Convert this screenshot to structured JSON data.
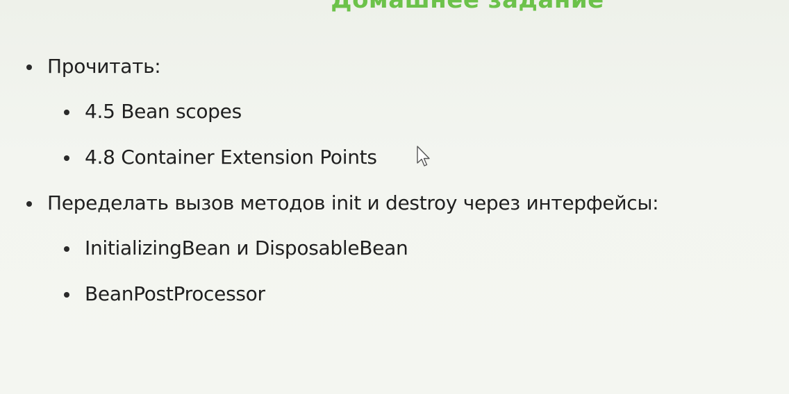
{
  "slide": {
    "title": "Домашнее задание",
    "items": [
      {
        "level": 1,
        "text": "Прочитать:"
      },
      {
        "level": 2,
        "text": "4.5 Bean scopes"
      },
      {
        "level": 2,
        "text": "4.8 Container Extension Points"
      },
      {
        "level": 1,
        "text": "Переделать вызов методов init и destroy через интерфейсы:"
      },
      {
        "level": 2,
        "text": "InitializingBean и DisposableBean"
      },
      {
        "level": 2,
        "text": "BeanPostProcessor"
      }
    ]
  },
  "colors": {
    "title": "#6cc24a",
    "text": "#1f1f1f",
    "background": "#f2f4ef"
  },
  "icons": {
    "cursor": "mouse-pointer-icon",
    "bullet": "bullet-dot-icon"
  }
}
